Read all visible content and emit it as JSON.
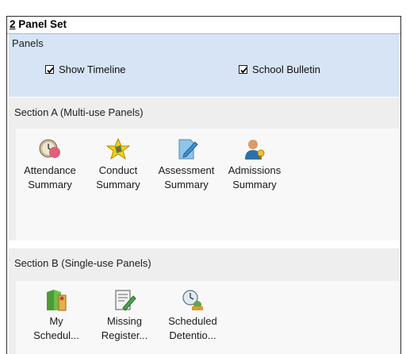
{
  "header": {
    "title_number": "2",
    "title_text": " Panel Set"
  },
  "panels": {
    "label": "Panels",
    "show_timeline": {
      "label": "Show Timeline",
      "checked": true
    },
    "school_bulletin": {
      "label": "School Bulletin",
      "checked": true
    }
  },
  "section_a": {
    "title": "Section A (Multi-use Panels)",
    "tiles": [
      {
        "line1": "Attendance",
        "line2": "Summary",
        "icon": "attendance-clock-icon"
      },
      {
        "line1": "Conduct",
        "line2": "Summary",
        "icon": "conduct-star-icon"
      },
      {
        "line1": "Assessment",
        "line2": "Summary",
        "icon": "assessment-pencil-icon"
      },
      {
        "line1": "Admissions",
        "line2": "Summary",
        "icon": "admissions-person-icon"
      }
    ]
  },
  "section_b": {
    "title": "Section B (Single-use Panels)",
    "tiles": [
      {
        "line1": "My",
        "line2": "Schedul...",
        "icon": "schedule-book-icon"
      },
      {
        "line1": "Missing",
        "line2": "Register...",
        "icon": "register-pencil-icon"
      },
      {
        "line1": "Scheduled",
        "line2": "Detentio...",
        "icon": "detention-clock-icon"
      }
    ]
  }
}
